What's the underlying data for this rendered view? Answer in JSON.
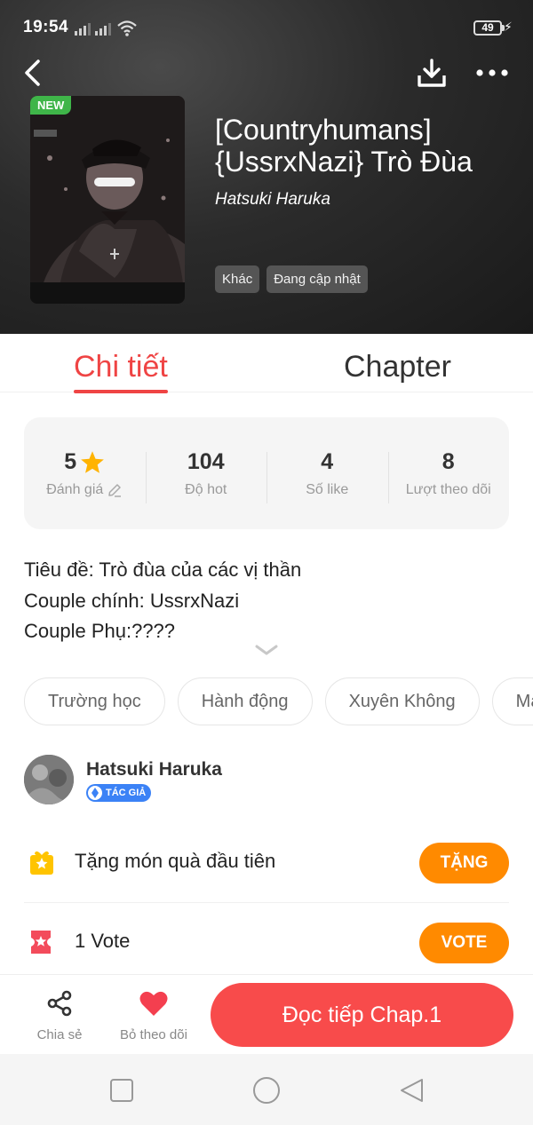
{
  "status_bar": {
    "time": "19:54",
    "battery": "49"
  },
  "book": {
    "badge": "NEW",
    "title": "[Countryhumans] {UssrxNazi} Trò Đùa",
    "author": "Hatsuki Haruka",
    "tags": [
      "Khác",
      "Đang cập nhật"
    ]
  },
  "tabs": {
    "details": "Chi tiết",
    "chapter": "Chapter"
  },
  "stats": [
    {
      "value": "5",
      "label": "Đánh giá"
    },
    {
      "value": "104",
      "label": "Độ hot"
    },
    {
      "value": "4",
      "label": "Số like"
    },
    {
      "value": "8",
      "label": "Lượt theo dõi"
    }
  ],
  "description": [
    "Tiêu đề: Trò đùa của các vị thần",
    "Couple chính: UssrxNazi",
    "Couple Phụ:????"
  ],
  "genres": [
    "Trường học",
    "Hành động",
    "Xuyên Không",
    "Mạo"
  ],
  "author_section": {
    "name": "Hatsuki Haruka",
    "badge": "TÁC GIẢ"
  },
  "gift": {
    "label": "Tặng món quà đầu tiên",
    "button": "TẶNG"
  },
  "vote": {
    "label": "1 Vote",
    "button": "VOTE"
  },
  "bottom_bar": {
    "share": "Chia sẻ",
    "unfollow": "Bỏ theo dõi",
    "read": "Đọc tiếp Chap.1"
  },
  "colors": {
    "accent": "#ef4444",
    "orange": "#ff8a00",
    "read_button": "#f84b4b",
    "new_badge": "#3fb549"
  }
}
